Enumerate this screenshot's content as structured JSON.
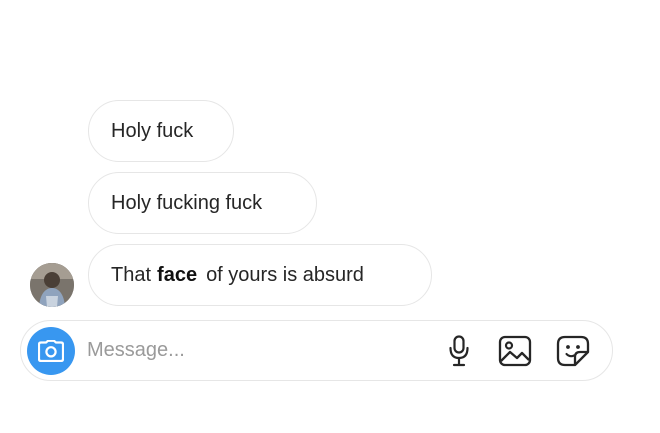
{
  "messages": [
    {
      "text": "Holy fuck"
    },
    {
      "text": "Holy fucking fuck"
    },
    {
      "text_before": "That",
      "text_emphasis": "face",
      "text_after": "of yours is absurd"
    }
  ],
  "composer": {
    "placeholder": "Message...",
    "icons": [
      "camera-icon",
      "microphone-icon",
      "image-gallery-icon",
      "sticker-icon"
    ]
  },
  "colors": {
    "bubble_border": "#e6e6e6",
    "camera_button": "#3897f0",
    "placeholder": "#9a9a9a",
    "text": "#262626"
  }
}
